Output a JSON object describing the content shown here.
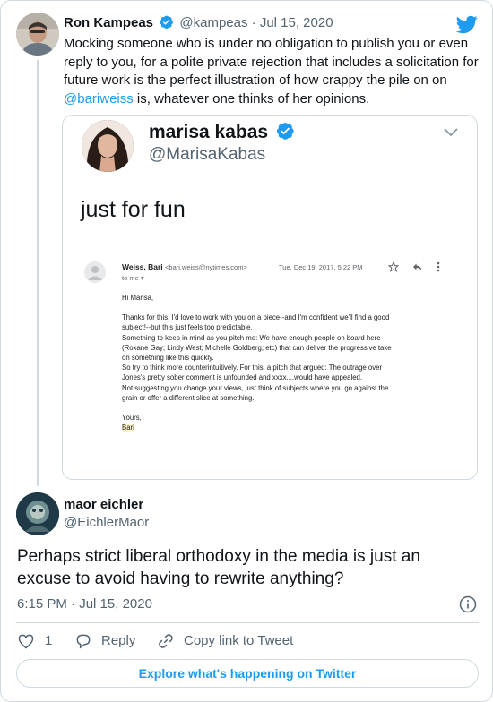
{
  "parent_tweet": {
    "author_name": "Ron Kampeas",
    "handle": "@kampeas",
    "separator": "·",
    "date": "Jul 15, 2020",
    "text_before_mention": "Mocking someone who is under no obligation to publish you or even reply to you, for a polite private rejection that includes a solicitation for future work is the perfect illustration of how crappy the pile on on ",
    "mention": "@bariweiss",
    "text_after_mention": " is, whatever one thinks of her opinions."
  },
  "quoted_tweet": {
    "author_name": "marisa kabas",
    "handle": "@MarisaKabas",
    "caption": "just for fun",
    "email": {
      "sender_name": "Weiss, Bari",
      "sender_address": "<bari.weiss@nytimes.com>",
      "date": "Tue, Dec 19, 2017, 5:22 PM",
      "to": "to me",
      "greeting": "Hi Marisa,",
      "lines": [
        "Thanks for this. I'd love to work with you on a piece--and I'm confident we'll find a good",
        "subject!--but this just feels too predictable.",
        "Something to keep in mind as you pitch me: We have enough people on board here",
        "(Roxane Gay; Lindy West; Michelle Goldberg; etc) that can deliver the progressive take",
        "on something like this quickly.",
        "So try to think more counterintuitively. For this, a pitch that argued: The outrage over",
        "Jones's pretty sober comment is unfounded and xxxx....would have appealed.",
        "Not suggesting you change your views, just think of subjects where you go against the",
        "grain or offer a different slice at something."
      ],
      "closing": "Yours,",
      "signature": "Bari"
    }
  },
  "reply_tweet": {
    "author_name": "maor eichler",
    "handle": "@EichlerMaor",
    "text": "Perhaps strict liberal orthodoxy in the media is just an excuse to avoid having to rewrite anything?",
    "time": "6:15 PM",
    "separator": "·",
    "date": "Jul 15, 2020",
    "like_count": "1",
    "reply_label": "Reply",
    "copy_link_label": "Copy link to Tweet"
  },
  "explore_label": "Explore what's happening on Twitter",
  "colors": {
    "accent": "#1d9bf0",
    "text": "#0f1419",
    "muted": "#536471",
    "border": "#cfd9de"
  },
  "icons": [
    "verified-badge-icon",
    "twitter-bird-icon",
    "chevron-down-icon",
    "star-icon",
    "reply-arrow-icon",
    "more-vertical-icon",
    "info-icon",
    "heart-icon",
    "reply-bubble-icon",
    "link-icon"
  ]
}
